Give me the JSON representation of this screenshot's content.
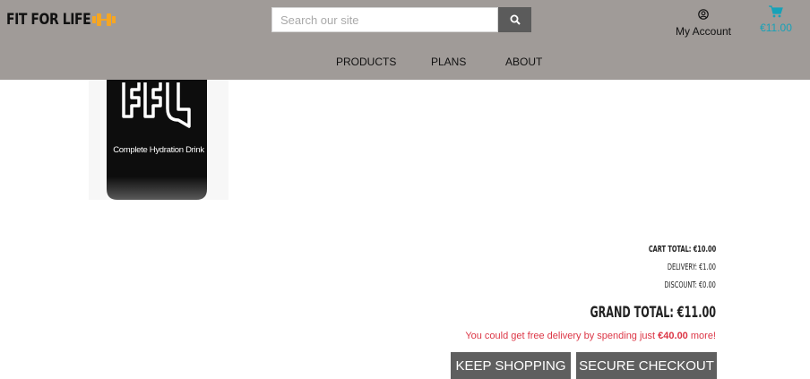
{
  "header": {
    "logo_text": "FIT FOR LIFE",
    "search": {
      "placeholder": "Search our site",
      "value": ""
    },
    "account_label": "My Account",
    "cart_total": "€11.00",
    "nav": [
      "PRODUCTS",
      "PLANS",
      "ABOUT"
    ]
  },
  "product": {
    "image_caption": "Complete Hydration Drink"
  },
  "summary": {
    "cart_total": "CART TOTAL: €10.00",
    "delivery": "DELIVERY: €1.00",
    "discount": "DISCOUNT: €0.00",
    "grand_total": "GRAND TOTAL: €11.00",
    "free_delivery_prefix": "You could get free delivery by spending just ",
    "free_delivery_amount": "€40.00",
    "free_delivery_suffix": " more!"
  },
  "buttons": {
    "keep_shopping": "KEEP SHOPPING",
    "secure_checkout": "SECURE CHECKOUT"
  },
  "colors": {
    "header_bg": "#a09b98",
    "accent": "#17a2b8",
    "alert": "#dc3545",
    "logo_accent": "#f5a623"
  },
  "icons": [
    "dumbbell-icon",
    "search-icon",
    "user-icon",
    "cart-icon"
  ]
}
